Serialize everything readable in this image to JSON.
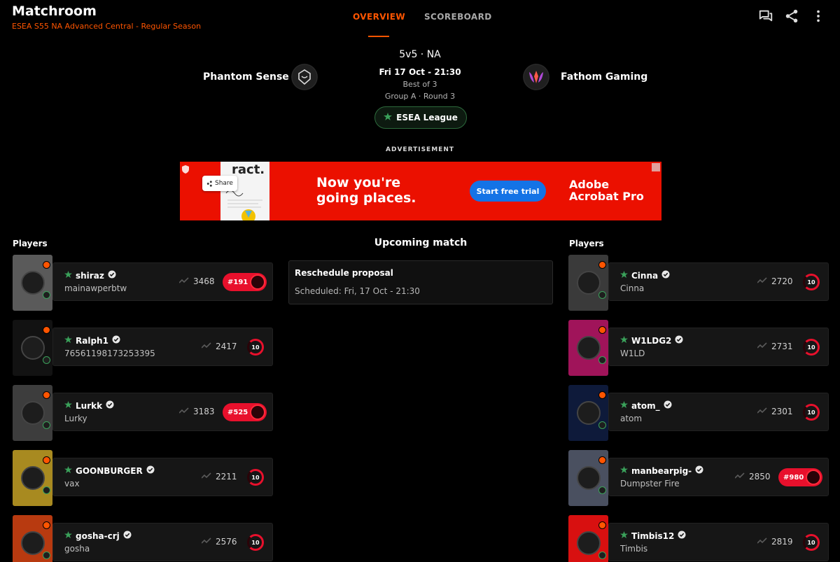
{
  "app": {
    "title": "Matchroom",
    "subtitle": "ESEA S55 NA Advanced Central - Regular Season"
  },
  "tabs": [
    {
      "label": "OVERVIEW",
      "active": true
    },
    {
      "label": "SCOREBOARD",
      "active": false
    }
  ],
  "header_icons": [
    "chat-icon",
    "share-icon",
    "more-vertical-icon"
  ],
  "match": {
    "mode": "5v5 · NA",
    "date": "Fri 17 Oct - 21:30",
    "best_of": "Best of 3",
    "round": "Group A · Round 3",
    "league": "ESEA League",
    "team_left": "Phantom Sense",
    "team_right": "Fathom Gaming"
  },
  "advertisement": {
    "label": "ADVERTISEMENT",
    "doc_text": "ract.",
    "share_label": "Share",
    "headline": "Now you're going places.",
    "cta": "Start free trial",
    "brand": "Adobe Acrobat Pro"
  },
  "columns": {
    "left_heading": "Players",
    "right_heading": "Players",
    "center_heading": "Upcoming match"
  },
  "upcoming": {
    "title": "Reschedule proposal",
    "scheduled": "Scheduled: Fri, 17 Oct - 21:30"
  },
  "colors": {
    "accent": "#ff5500",
    "rank_red": "#e8102c",
    "verified_green": "#3aa15a"
  },
  "players_left": [
    {
      "name": "shiraz",
      "sub": "mainawperbtw",
      "elo": "3468",
      "rank": "#191",
      "level": "10",
      "avatar_bg": "#5a5a5a"
    },
    {
      "name": "Ralph1",
      "sub": "76561198173253395",
      "elo": "2417",
      "rank": "",
      "level": "10",
      "avatar_bg": "#121212"
    },
    {
      "name": "Lurkk",
      "sub": "Lurky",
      "elo": "3183",
      "rank": "#525",
      "level": "10",
      "avatar_bg": "#3d3d3d"
    },
    {
      "name": "GOONBURGER",
      "sub": "vax",
      "elo": "2211",
      "rank": "",
      "level": "10",
      "avatar_bg": "#a88a20"
    },
    {
      "name": "gosha-crj",
      "sub": "gosha",
      "elo": "2576",
      "rank": "",
      "level": "10",
      "avatar_bg": "#b83a10"
    }
  ],
  "players_right": [
    {
      "name": "Cinna",
      "sub": "Cinna",
      "elo": "2720",
      "rank": "",
      "level": "10",
      "avatar_bg": "#3a3a3a"
    },
    {
      "name": "W1LDG2",
      "sub": "W1LD",
      "elo": "2731",
      "rank": "",
      "level": "10",
      "avatar_bg": "#a0145a"
    },
    {
      "name": "atom_",
      "sub": "atom",
      "elo": "2301",
      "rank": "",
      "level": "10",
      "avatar_bg": "#0e1a3a"
    },
    {
      "name": "manbearpig-",
      "sub": "Dumpster Fire",
      "elo": "2850",
      "rank": "#980",
      "level": "10",
      "avatar_bg": "#4a5060"
    },
    {
      "name": "Timbis12",
      "sub": "Timbis",
      "elo": "2819",
      "rank": "",
      "level": "10",
      "avatar_bg": "#d81010"
    }
  ]
}
